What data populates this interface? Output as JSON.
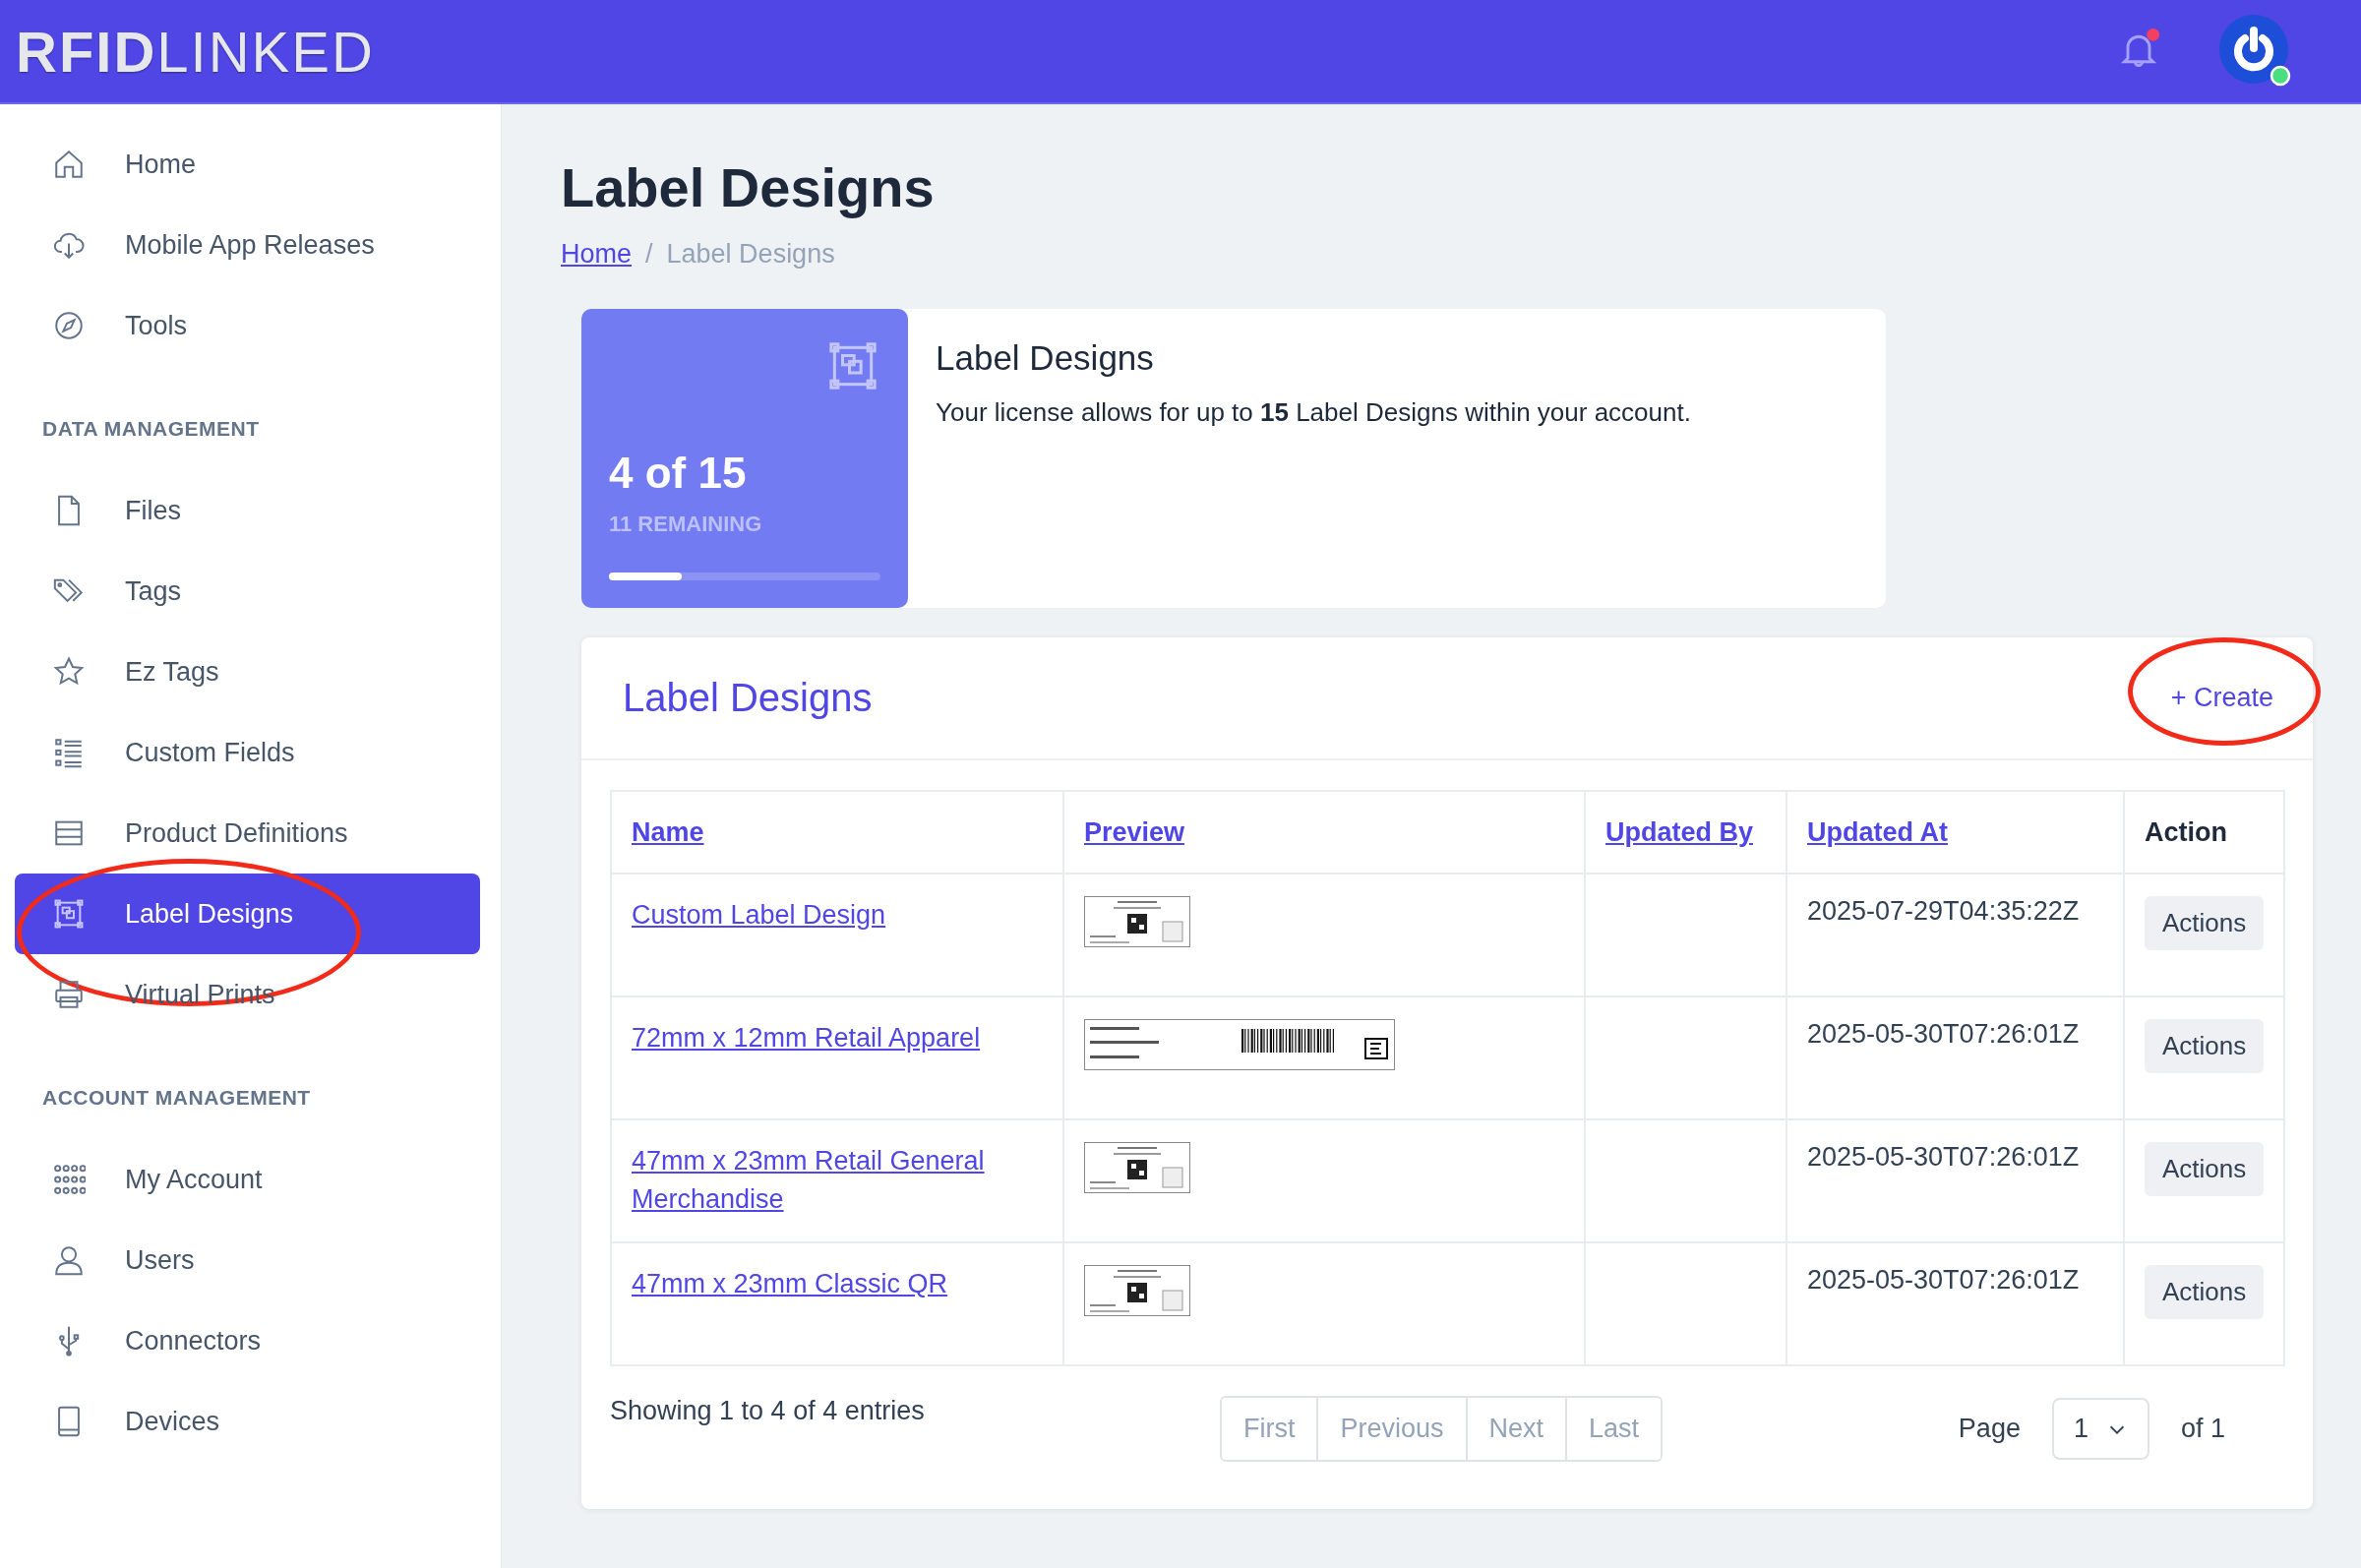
{
  "header": {
    "logo_bold": "RFID",
    "logo_light": "LINKED",
    "notification_dot": true,
    "user_online": true
  },
  "sidebar": {
    "sections": [
      {
        "items": [
          {
            "label": "Home",
            "selected": false,
            "circled": false
          },
          {
            "label": "Mobile App Releases",
            "selected": false,
            "circled": false
          },
          {
            "label": "Tools",
            "selected": false,
            "circled": false
          }
        ]
      },
      {
        "heading": "DATA MANAGEMENT",
        "items": [
          {
            "label": "Files",
            "selected": false,
            "circled": false
          },
          {
            "label": "Tags",
            "selected": false,
            "circled": false
          },
          {
            "label": "Ez Tags",
            "selected": false,
            "circled": false
          },
          {
            "label": "Custom Fields",
            "selected": false,
            "circled": false
          },
          {
            "label": "Product Definitions",
            "selected": false,
            "circled": false
          },
          {
            "label": "Label Designs",
            "selected": true,
            "circled": true
          },
          {
            "label": "Virtual Prints",
            "selected": false,
            "circled": false
          }
        ]
      },
      {
        "heading": "ACCOUNT MANAGEMENT",
        "items": [
          {
            "label": "My Account",
            "selected": false,
            "circled": false
          },
          {
            "label": "Users",
            "selected": false,
            "circled": false
          },
          {
            "label": "Connectors",
            "selected": false,
            "circled": false
          },
          {
            "label": "Devices",
            "selected": false,
            "circled": false
          }
        ]
      }
    ]
  },
  "page": {
    "title": "Label Designs",
    "breadcrumb_separator": "/",
    "breadcrumb": [
      {
        "label": "Home",
        "link": true
      },
      {
        "label": "Label Designs",
        "link": false
      }
    ]
  },
  "license": {
    "count": "4 of 15",
    "remaining": "11 REMAINING",
    "level": 0.267,
    "title": "Label Designs",
    "text": "Your license allows for up to **15** Label Designs within your account."
  },
  "table_card": {
    "title": "Label Designs",
    "create_button": "+ Create",
    "create_circled": true,
    "columns": [
      {
        "label": "Name",
        "sortable": true
      },
      {
        "label": "Preview",
        "sortable": true
      },
      {
        "label": "Updated By",
        "sortable": true
      },
      {
        "label": "Updated At",
        "sortable": true
      },
      {
        "label": "Action",
        "sortable": false
      }
    ],
    "rows": [
      {
        "name": "Custom Label Design",
        "updated_at": "2025-07-29T04:35:22Z",
        "action": "Actions"
      },
      {
        "name": "72mm x 12mm Retail Apparel",
        "updated_at": "2025-05-30T07:26:01Z",
        "action": "Actions"
      },
      {
        "name": "47mm x 23mm Retail General Merchandise",
        "updated_at": "2025-05-30T07:26:01Z",
        "action": "Actions"
      },
      {
        "name": "47mm x 23mm Classic QR",
        "updated_at": "2025-05-30T07:26:01Z",
        "action": "Actions"
      }
    ],
    "summary": "Showing 1 to 4 of 4 entries",
    "pager": [
      {
        "label": "First",
        "disabled": true
      },
      {
        "label": "Previous",
        "disabled": true
      },
      {
        "label": "Next",
        "disabled": true
      },
      {
        "label": "Last",
        "disabled": true
      }
    ],
    "page_label": "Page",
    "page_value": "1",
    "page_of": "of 1"
  }
}
